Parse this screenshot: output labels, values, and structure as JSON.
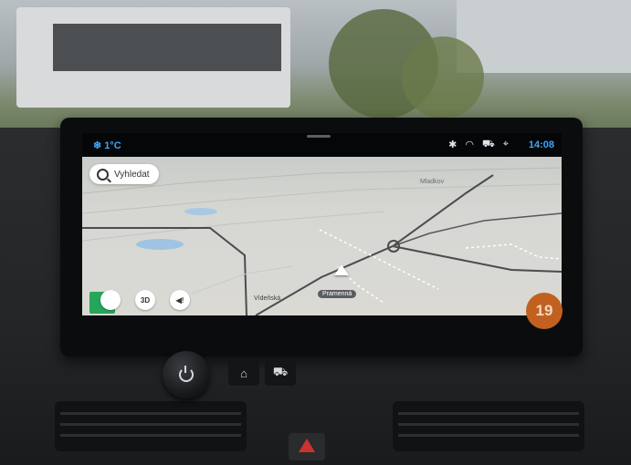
{
  "status_bar": {
    "temperature": "❄ 1°C",
    "bluetooth_icon": "bluetooth-icon",
    "wifi_icon": "wifi-icon",
    "car_icon": "car-icon",
    "location_icon": "location-icon",
    "time": "14:08"
  },
  "map": {
    "search_placeholder": "Vyhledat",
    "labels": {
      "mladkov": "Mladkov",
      "street": "Vídeňská",
      "current_street": "Pramenná"
    },
    "buttons": {
      "three_d": "3D",
      "sound": "◀!"
    }
  },
  "speed_limit": "19",
  "colors": {
    "accent": "#3aa7ff",
    "speed_badge": "#c2611f",
    "map_bg": "#d6d7d3"
  }
}
